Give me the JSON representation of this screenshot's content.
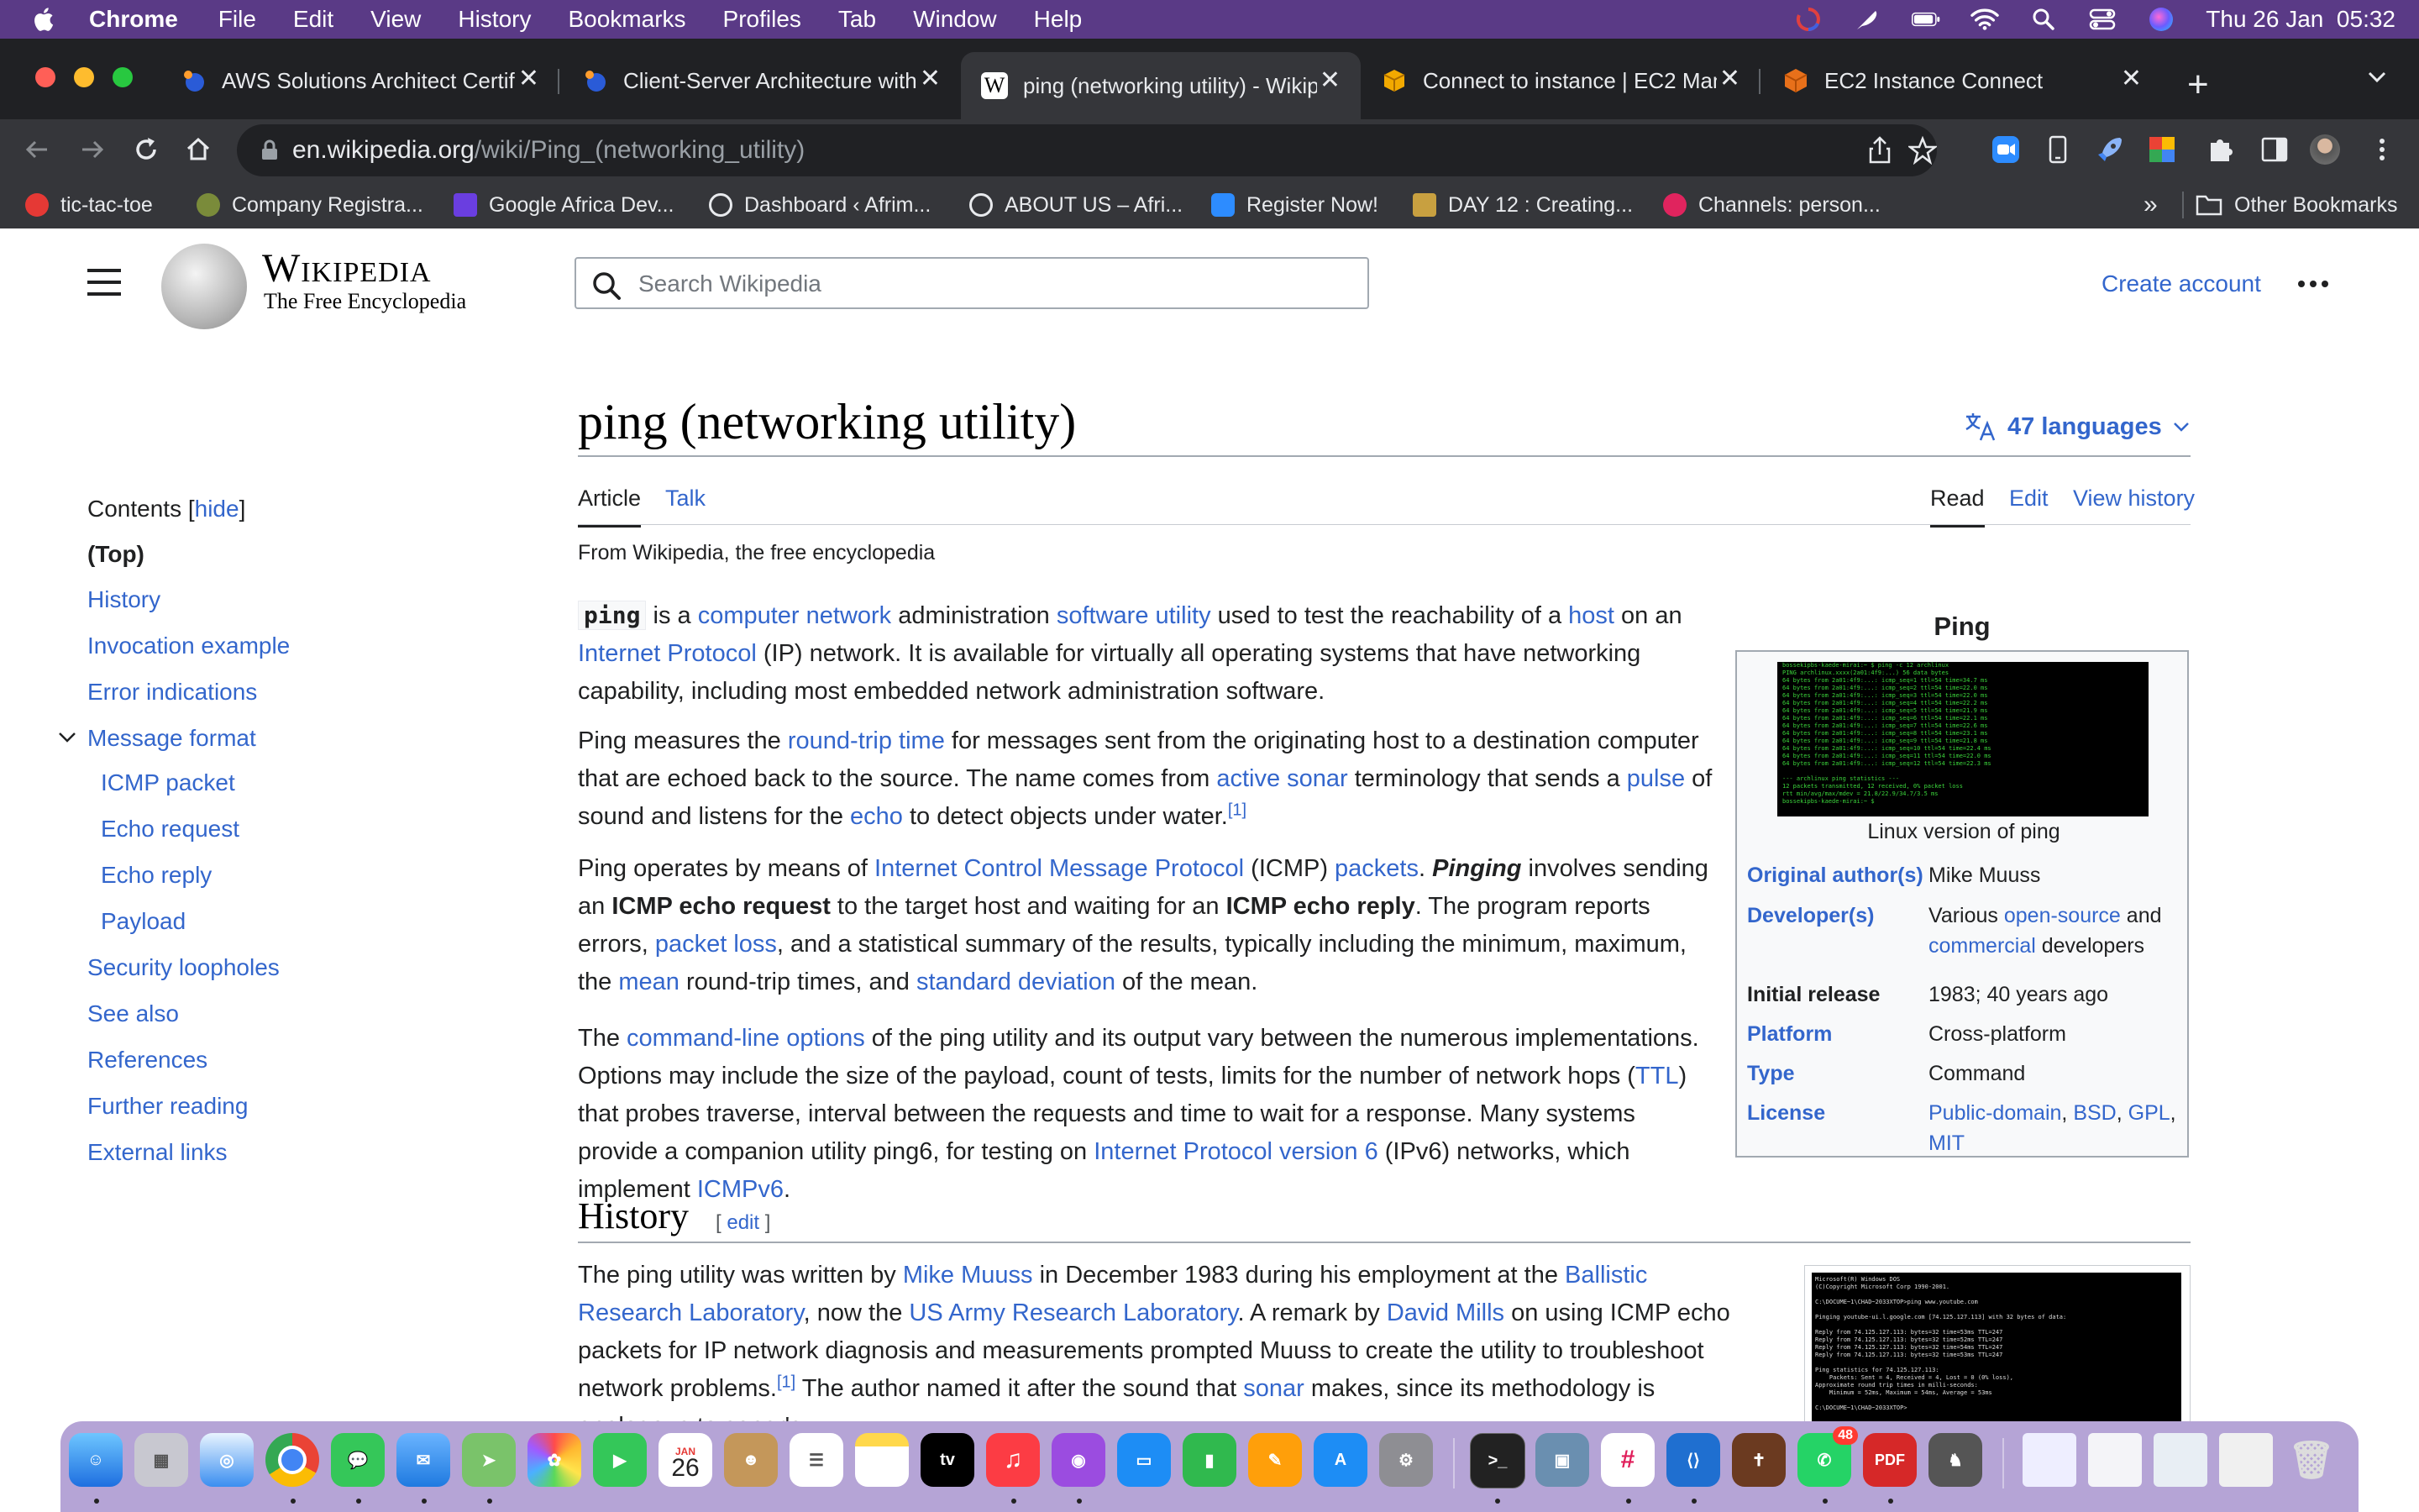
{
  "menubar": {
    "app_name": "Chrome",
    "items": [
      "File",
      "Edit",
      "View",
      "History",
      "Bookmarks",
      "Profiles",
      "Tab",
      "Window",
      "Help"
    ],
    "clock": "Thu 26 Jan  05:32"
  },
  "tabs": [
    {
      "title": "AWS Solutions Architect Certifi",
      "color": "#4285f4"
    },
    {
      "title": "Client-Server Architecture with",
      "color": "#4285f4"
    },
    {
      "title": "ping (networking utility) - Wikip",
      "color": "#ffffff",
      "fav_text": "W"
    },
    {
      "title": "Connect to instance | EC2 Man",
      "color": "#f2a900"
    },
    {
      "title": "EC2 Instance Connect",
      "color": "#e8701a"
    }
  ],
  "omnibox": {
    "domain": "en.wikipedia.org",
    "path": "/wiki/Ping_(networking_utility)"
  },
  "bookmarks": [
    {
      "label": "tic-tac-toe",
      "color": "#e53935"
    },
    {
      "label": "Company Registra...",
      "color": "#7a8b3a"
    },
    {
      "label": "Google Africa Dev...",
      "color": "#6a3ee0"
    },
    {
      "label": "Dashboard ‹ Afrim...",
      "color": "#e8eaed"
    },
    {
      "label": "ABOUT US – Afri...",
      "color": "#e8eaed"
    },
    {
      "label": "Register Now!",
      "color": "#2d8cff"
    },
    {
      "label": "DAY 12 : Creating...",
      "color": "#c8a040"
    },
    {
      "label": "Channels: person...",
      "color": "#e0245e"
    }
  ],
  "bookmarks_overflow": "»",
  "other_bookmarks": "Other Bookmarks",
  "wiki": {
    "wordmark": "Wikipedia",
    "tagline": "The Free Encyclopedia",
    "search_placeholder": "Search Wikipedia",
    "create_account": "Create account",
    "toc": {
      "title": "Contents",
      "hide": "hide",
      "items": [
        "(Top)",
        "History",
        "Invocation example",
        "Error indications",
        "Message format",
        "ICMP packet",
        "Echo request",
        "Echo reply",
        "Payload",
        "Security loopholes",
        "See also",
        "References",
        "Further reading",
        "External links"
      ]
    },
    "title": "ping (networking utility)",
    "languages": "47 languages",
    "tabs": {
      "article": "Article",
      "talk": "Talk",
      "read": "Read",
      "edit": "Edit",
      "history": "View history"
    },
    "from": "From Wikipedia, the free encyclopedia",
    "p1": {
      "code": "ping",
      "a": " is a ",
      "l1": "computer network",
      "b": " administration ",
      "l2": "software utility",
      "c": " used to test the reachability of a ",
      "l3": "host",
      "d": " on an ",
      "l4": "Internet Protocol",
      "e": " (IP) network. It is available for virtually all operating systems that have networking capability, including most embedded network administration software."
    },
    "p2": {
      "a": "Ping measures the ",
      "l1": "round-trip time",
      "b": " for messages sent from the originating host to a destination computer that are echoed back to the source. The name comes from ",
      "l2": "active sonar",
      "c": " terminology that sends a ",
      "l3": "pulse",
      "d": " of sound and listens for the ",
      "l4": "echo",
      "e": " to detect objects under water.",
      "ref": "[1]"
    },
    "p3": {
      "a": "Ping operates by means of ",
      "l1": "Internet Control Message Protocol",
      "b": " (ICMP) ",
      "l2": "packets",
      "c": ". ",
      "pinging": "Pinging",
      "d": " involves sending an ",
      "b1": "ICMP echo request",
      "e": " to the target host and waiting for an ",
      "b2": "ICMP echo reply",
      "f": ". The program reports errors, ",
      "l3": "packet loss",
      "g": ", and a statistical summary of the results, typically including the minimum, maximum, the ",
      "l4": "mean",
      "h": " round-trip times, and ",
      "l5": "standard deviation",
      "i": " of the mean."
    },
    "p4": {
      "a": "The ",
      "l1": "command-line options",
      "b": " of the ping utility and its output vary between the numerous implementations. Options may include the size of the payload, count of tests, limits for the number of network hops (",
      "l2": "TTL",
      "c": ") that probes traverse, interval between the requests and time to wait for a response. Many systems provide a companion utility ping6, for testing on ",
      "l3": "Internet Protocol version 6",
      "d": " (IPv6) networks, which implement ",
      "l4": "ICMPv6",
      "e": "."
    },
    "infobox": {
      "title": "Ping",
      "caption": "Linux version of ping",
      "rows": [
        {
          "k": "Original author(s)",
          "v": "Mike Muuss"
        },
        {
          "k": "Developer(s)",
          "v_a": "Various ",
          "v_l1": "open-source",
          "v_b": " and ",
          "v_l2": "commercial",
          "v_c": " developers"
        },
        {
          "k": "Initial release",
          "v": "1983; 40 years ago"
        },
        {
          "k": "Platform",
          "v": "Cross-platform"
        },
        {
          "k": "Type",
          "v": "Command"
        },
        {
          "k": "License",
          "v_l1": "Public-domain",
          "v_l2": "BSD",
          "v_l3": "GPL",
          "v_l4": "MIT"
        }
      ]
    },
    "history": {
      "heading": "History",
      "edit": "edit",
      "a": "The ping utility was written by ",
      "l1": "Mike Muuss",
      "b": " in December 1983 during his employment at the ",
      "l2": "Ballistic Research Laboratory",
      "c": ", now the ",
      "l3": "US Army Research Laboratory",
      "d": ". A remark by ",
      "l4": "David Mills",
      "e": " on using ICMP echo packets for IP network diagnosis and measurements prompted Muuss to create the utility to troubleshoot network problems.",
      "ref": "[1]",
      "f": " The author named it after the sound that ",
      "l5": "sonar",
      "g": " makes, since its methodology is analogous to sonar's"
    }
  },
  "dock": {
    "calendar_month": "JAN",
    "calendar_day": "26",
    "tv_label": "tv",
    "pdf_label": "PDF",
    "whatsapp_badge": "48"
  },
  "colors": {
    "menubar": "#5a3a86",
    "link": "#3366cc",
    "chrome_dark": "#202124"
  }
}
